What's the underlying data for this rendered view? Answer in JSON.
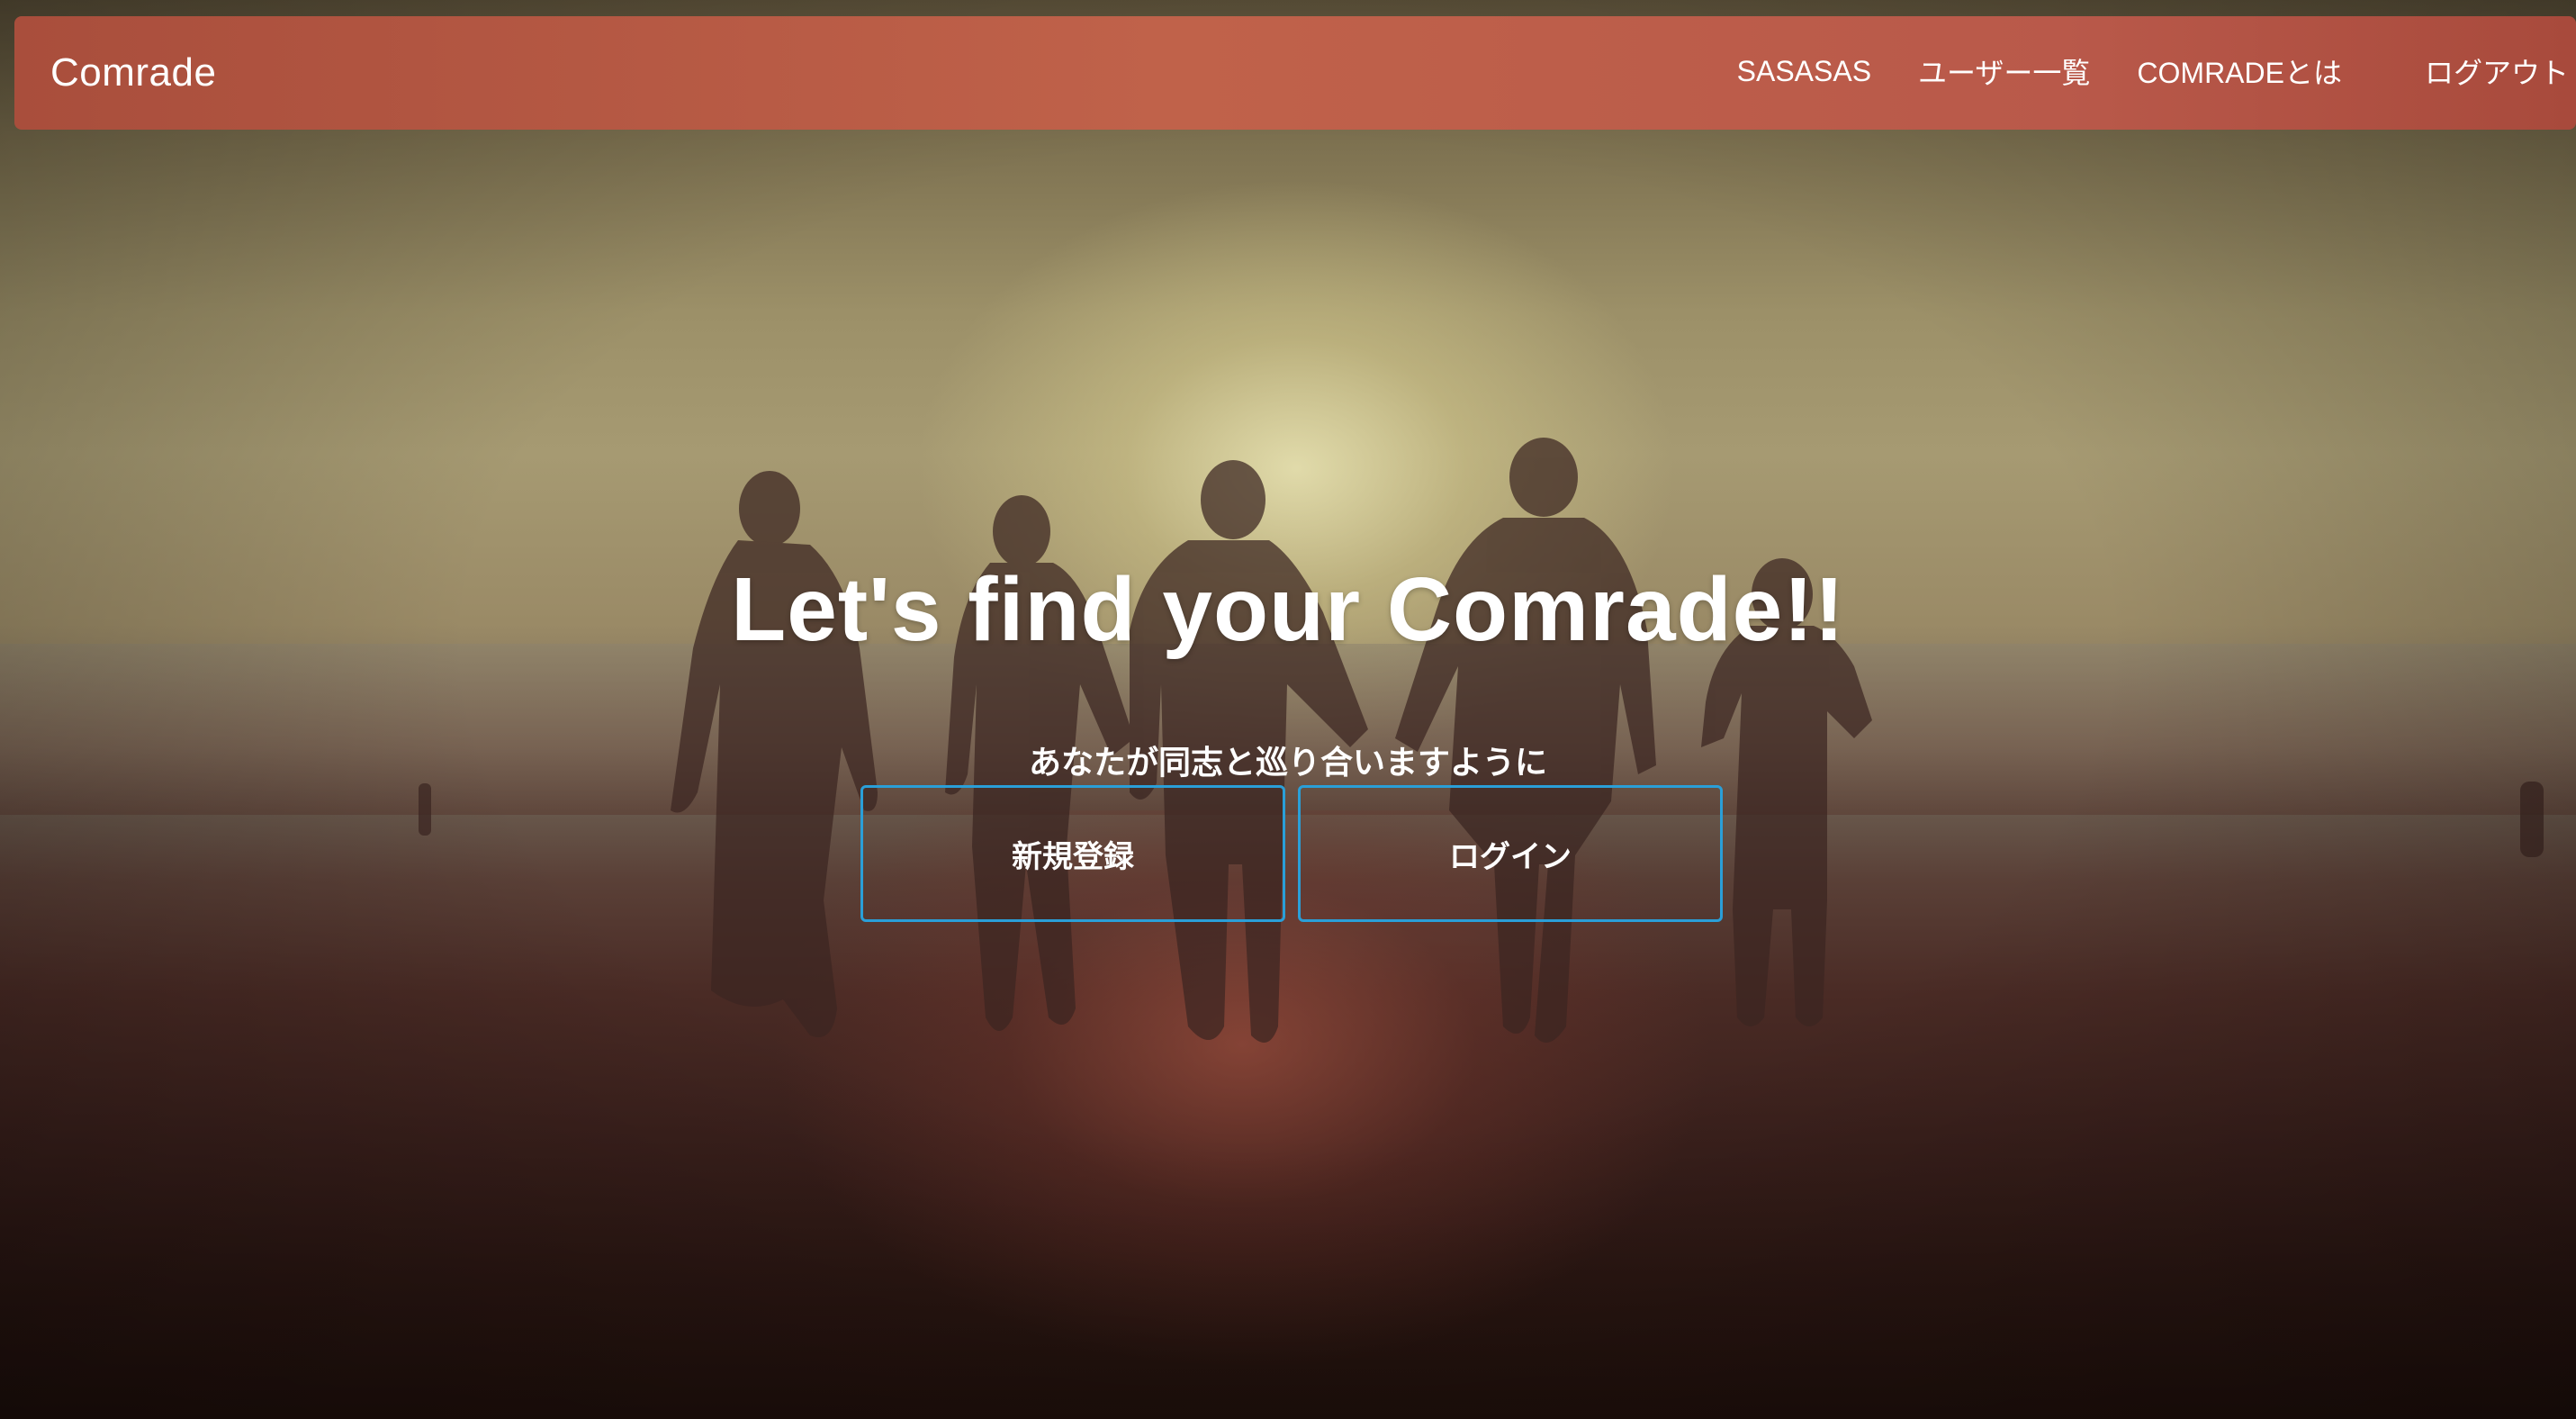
{
  "navbar": {
    "brand": "Comrade",
    "links": [
      {
        "label": "SASASAS"
      },
      {
        "label": "ユーザー一覧"
      },
      {
        "label": "COMRADEとは"
      },
      {
        "label": "ログアウト"
      }
    ]
  },
  "hero": {
    "title": "Let's find your Comrade!!",
    "subtitle": "あなたが同志と巡り合いますように",
    "buttons": {
      "register_label": "新規登録",
      "login_label": "ログイン"
    }
  },
  "colors": {
    "navbar": "#b9584a",
    "button_border": "#2a9fd8",
    "text": "#ffffff"
  },
  "icons": []
}
